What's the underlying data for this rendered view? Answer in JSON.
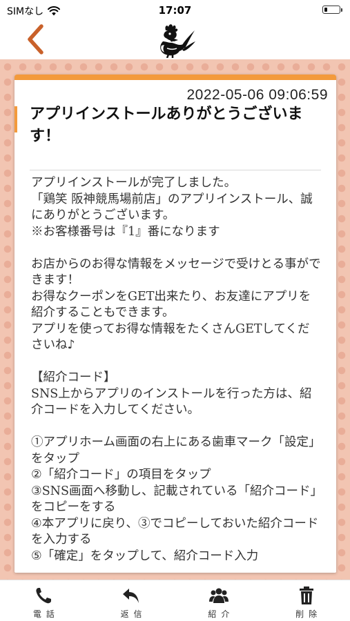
{
  "status_bar": {
    "carrier": "SIMなし",
    "time": "17:07",
    "battery_level": 0.2
  },
  "nav": {
    "back_icon": "chevron-left-icon",
    "logo_icon": "rooster-logo-icon",
    "accent_color": "#c9612a"
  },
  "message": {
    "date": "2022-05-06 09:06:59",
    "title": "アプリインストールありがとうございます！",
    "body": "アプリインストールが完了しました。\n「鶏笑 阪神競馬場前店」のアプリインストール、誠にありがとうございます。\n※お客様番号は『1』番になります\n\nお店からのお得な情報をメッセージで受けとる事ができます！\nお得なクーポンをGET出来たり、お友達にアプリを紹介することもできます。\nアプリを使ってお得な情報をたくさんGETしてくださいね♪\n\n【紹介コード】\nSNS上からアプリのインストールを行った方は、紹介コードを入力してください。\n\n①アプリホーム画面の右上にある歯車マーク「設定」をタップ\n②「紹介コード」の項目をタップ\n③SNS画面へ移動し、記載されている「紹介コード」をコピーをする\n④本アプリに戻り、③でコピーしておいた紹介コードを入力する\n⑤「確定」をタップして、紹介コード入力"
  },
  "tab_bar": {
    "tabs": [
      {
        "label": "電話",
        "icon": "phone-icon"
      },
      {
        "label": "返信",
        "icon": "reply-icon"
      },
      {
        "label": "紹介",
        "icon": "users-icon"
      },
      {
        "label": "削除",
        "icon": "trash-icon"
      }
    ]
  },
  "colors": {
    "card_accent": "#f39a3c",
    "background": "#f2c5b2",
    "background_dot": "#e9ad98"
  }
}
